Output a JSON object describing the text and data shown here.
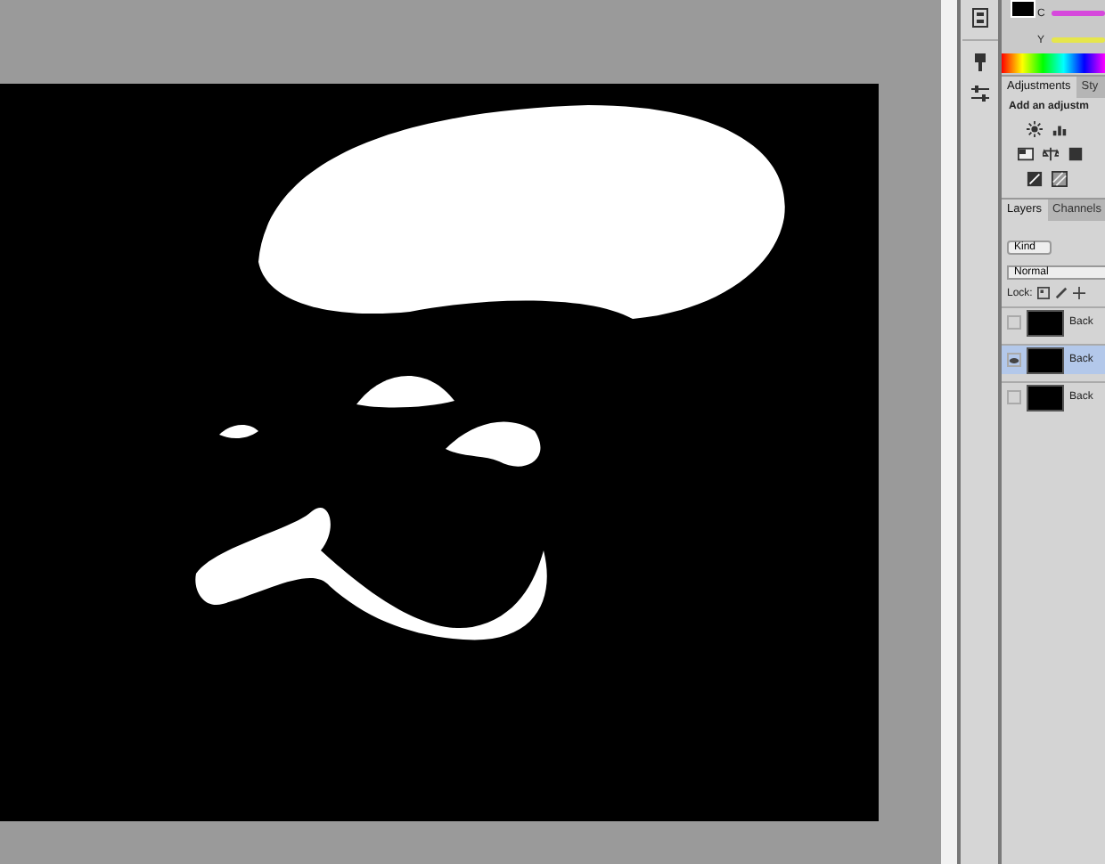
{
  "color_panel": {
    "channels": [
      {
        "label": "C",
        "color": "#d648dc"
      },
      {
        "label": "Y",
        "color": "#e6e64c"
      }
    ]
  },
  "adjustments_panel": {
    "tabs": [
      {
        "label": "Adjustments",
        "selected": true
      },
      {
        "label": "Sty",
        "selected": false
      }
    ],
    "heading": "Add an adjustm"
  },
  "layers_panel": {
    "tabs": [
      {
        "label": "Layers",
        "selected": true
      },
      {
        "label": "Channels",
        "selected": false
      }
    ],
    "filter": "Kind",
    "blend_mode": "Normal",
    "lock_label": "Lock:",
    "layers": [
      {
        "name": "Back",
        "visible": false,
        "selected": false
      },
      {
        "name": "Back",
        "visible": true,
        "selected": true
      },
      {
        "name": "Back",
        "visible": false,
        "selected": false
      }
    ]
  }
}
